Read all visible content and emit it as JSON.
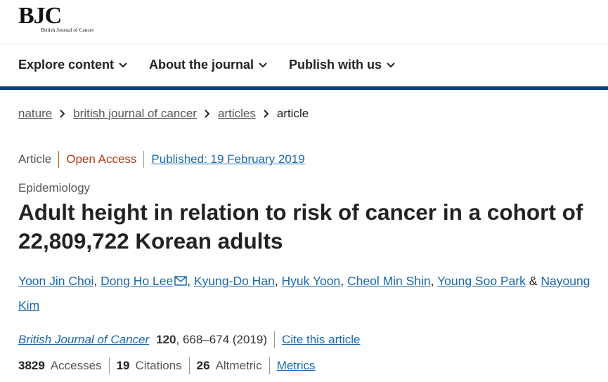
{
  "logo": {
    "main": "BJC",
    "sub": "British Journal of Cancer"
  },
  "nav": {
    "items": [
      {
        "label": "Explore content"
      },
      {
        "label": "About the journal"
      },
      {
        "label": "Publish with us"
      }
    ],
    "bar_color": "#0c3c7c"
  },
  "breadcrumb": [
    "nature",
    "british journal of cancer",
    "articles",
    "article"
  ],
  "meta": {
    "type": "Article",
    "access": "Open Access",
    "published": "Published: 19 February 2019"
  },
  "subject": "Epidemiology",
  "title": "Adult height in relation to risk of cancer in a cohort of 22,809,722 Korean adults",
  "authors": {
    "list": [
      "Yoon Jin Choi",
      "Dong Ho Lee",
      "Kyung-Do Han",
      "Hyuk Yoon",
      "Cheol Min Shin",
      "Young Soo Park",
      "Nayoung Kim"
    ],
    "sep": ",",
    "and": "&",
    "corresponding_icon": "mail-icon"
  },
  "citation": {
    "journal": "British Journal of Cancer",
    "volume": "120",
    "pages_year": ", 668–674 (2019)",
    "cite_label": "Cite this article"
  },
  "metrics": {
    "accesses_value": "3829",
    "accesses_label": "Accesses",
    "citations_value": "19",
    "citations_label": "Citations",
    "altmetric_value": "26",
    "altmetric_label": "Altmetric",
    "metrics_link": "Metrics"
  },
  "colors": {
    "link": "#1868b0",
    "open_access": "#b23b14",
    "accent_bar": "#0c3c7c"
  }
}
